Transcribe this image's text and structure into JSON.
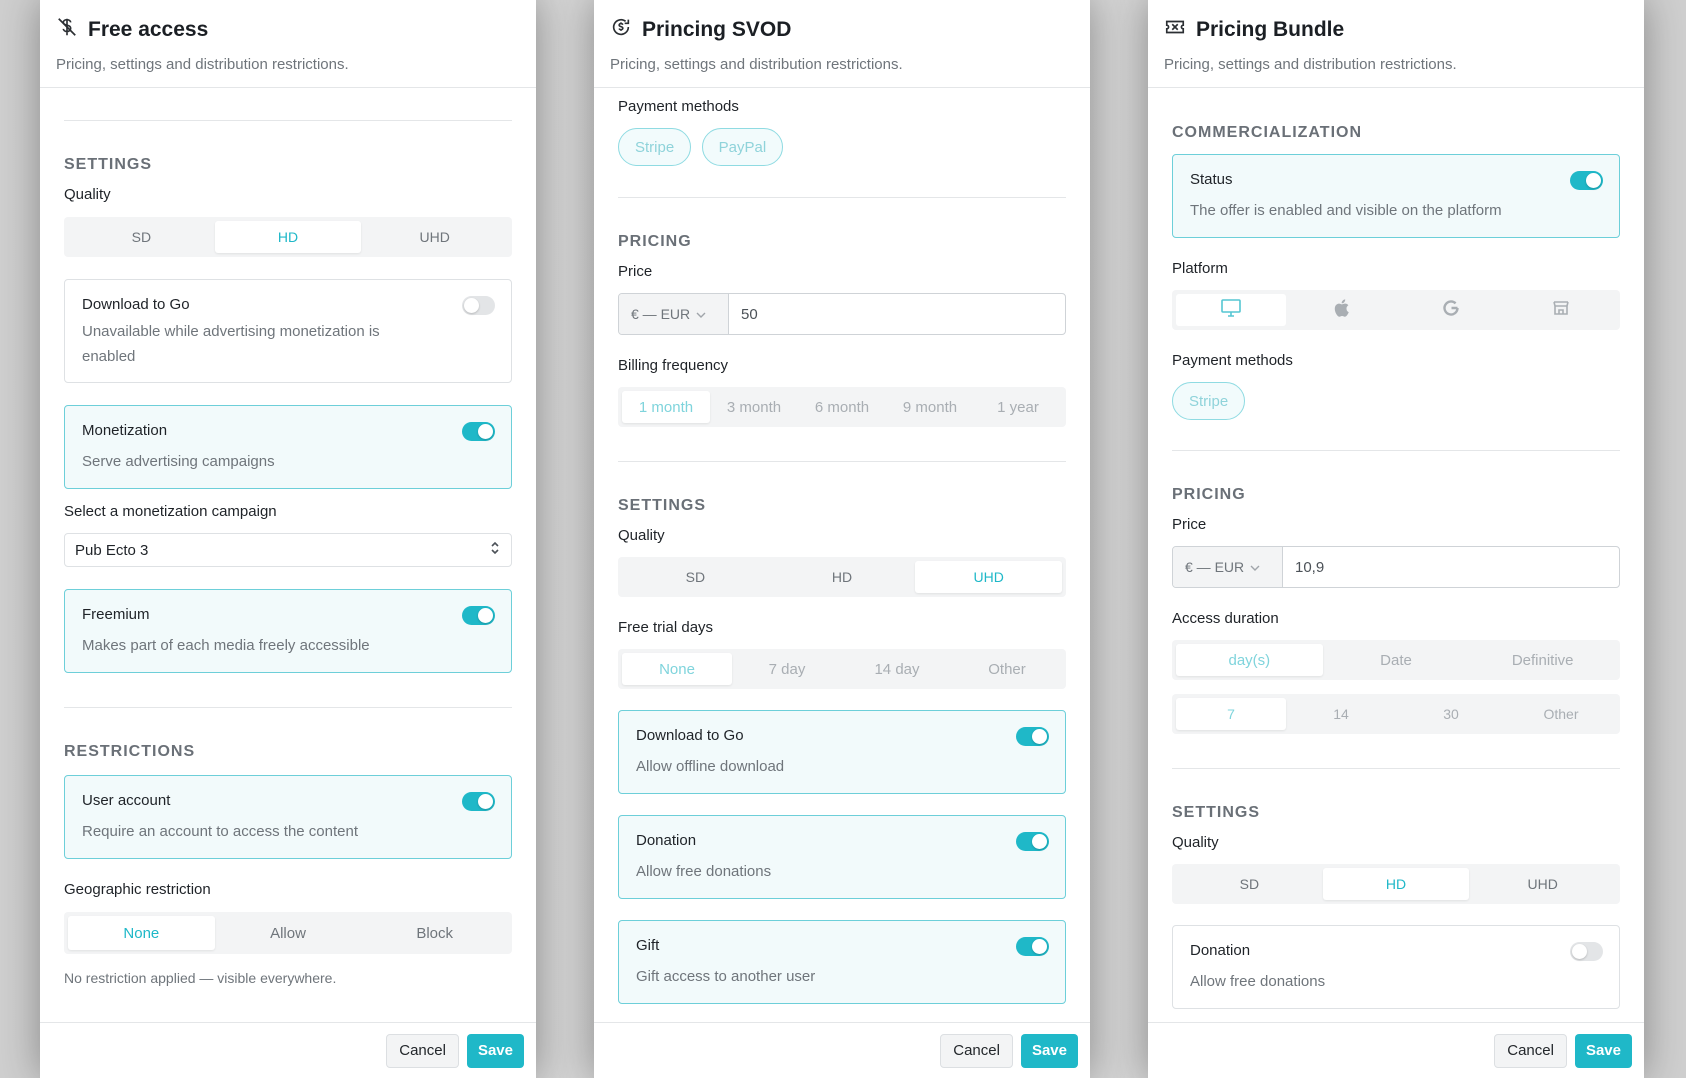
{
  "free": {
    "title": "Free access",
    "subtitle": "Pricing, settings and distribution restrictions.",
    "settings_heading": "SETTINGS",
    "quality_label": "Quality",
    "quality_options": [
      "SD",
      "HD",
      "UHD"
    ],
    "download_title": "Download to Go",
    "download_desc": "Unavailable while advertising monetization is enabled",
    "monetization_title": "Monetization",
    "monetization_desc": "Serve advertising campaigns",
    "campaign_label": "Select a monetization campaign",
    "campaign_value": "Pub Ecto 3",
    "freemium_title": "Freemium",
    "freemium_desc": "Makes part of each media freely accessible",
    "restrictions_heading": "RESTRICTIONS",
    "account_title": "User account",
    "account_desc": "Require an account to access the content",
    "geo_label": "Geographic restriction",
    "geo_options": [
      "None",
      "Allow",
      "Block"
    ],
    "geo_note": "No restriction applied — visible everywhere.",
    "cancel": "Cancel",
    "save": "Save"
  },
  "svod": {
    "title": "Princing SVOD",
    "subtitle": "Pricing, settings and distribution restrictions.",
    "payment_label": "Payment methods",
    "payment_methods": [
      "Stripe",
      "PayPal"
    ],
    "pricing_heading": "PRICING",
    "price_label": "Price",
    "currency": "€ — EUR",
    "price_value": "50",
    "billing_label": "Billing frequency",
    "billing_options": [
      "1 month",
      "3 month",
      "6 month",
      "9 month",
      "1 year"
    ],
    "settings_heading": "SETTINGS",
    "quality_label": "Quality",
    "quality_options": [
      "SD",
      "HD",
      "UHD"
    ],
    "trial_label": "Free trial days",
    "trial_options": [
      "None",
      "7 day",
      "14 day",
      "Other"
    ],
    "download_title": "Download to Go",
    "download_desc": "Allow offline download",
    "donation_title": "Donation",
    "donation_desc": "Allow free donations",
    "gift_title": "Gift",
    "gift_desc": "Gift access to another user",
    "cancel": "Cancel",
    "save": "Save"
  },
  "bundle": {
    "title": "Pricing Bundle",
    "subtitle": "Pricing, settings and distribution restrictions.",
    "commercialization_heading": "COMMERCIALIZATION",
    "status_title": "Status",
    "status_desc": "The offer is enabled and visible on the platform",
    "platform_label": "Platform",
    "payment_label": "Payment methods",
    "payment_methods": [
      "Stripe"
    ],
    "pricing_heading": "PRICING",
    "price_label": "Price",
    "currency": "€ — EUR",
    "price_value": "10,9",
    "access_label": "Access duration",
    "access_options": [
      "day(s)",
      "Date",
      "Definitive"
    ],
    "days_options": [
      "7",
      "14",
      "30",
      "Other"
    ],
    "settings_heading": "SETTINGS",
    "quality_label": "Quality",
    "quality_options": [
      "SD",
      "HD",
      "UHD"
    ],
    "donation_title": "Donation",
    "donation_desc": "Allow free donations",
    "cancel": "Cancel",
    "save": "Save"
  },
  "colors": {
    "accent": "#1fb8c8",
    "accent_border": "#6dcfd9",
    "card_bg": "#f2fafb"
  }
}
